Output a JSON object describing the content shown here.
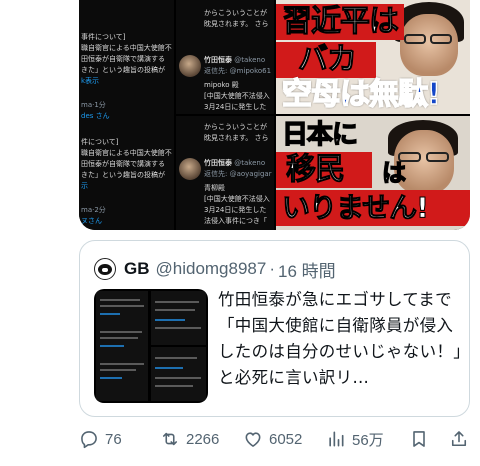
{
  "media": {
    "tile1": {
      "lines": [
        "事件について]",
        "職自衛官による中国大使館不",
        "田恒泰が自衛隊で講演する",
        "きた」という趣旨の投稿が",
        "k表示",
        "ma·1分",
        "des さん",
        "件について]",
        "職自衛官による中国大使館不",
        "田恒泰が自衛隊で講演する",
        "きた」という趣旨の投稿が",
        "示",
        "ma·2分",
        "ヌさん"
      ]
    },
    "tile2": {
      "top_lines": [
        "からこういうことが",
        "眈見されます。 さら"
      ],
      "name": "竹田恒泰",
      "handle": "@takeno",
      "reply_to": "返信先: @mipoko61",
      "body": [
        "mipoko 殿",
        "[中国大使館不法侵入",
        "3月24日に発生した",
        "法侵入事件につき「"
      ]
    },
    "tile3": {
      "top_lines": [
        "からこういうことが",
        "眈見されます。 さら"
      ],
      "name": "竹田恒泰",
      "handle": "@takeno",
      "reply_to": "返信先: @aoyagigar",
      "body": [
        "青柳殿",
        "[中国大使館不法侵入",
        "3月24日に発生した",
        "法侵入事件につき「"
      ]
    },
    "tile4": {
      "line1": "習近平は",
      "line2": "バカ",
      "line3": "空母は無駄!"
    },
    "tile5": {
      "line1": "日本に",
      "line2": "移民",
      "line3": "は",
      "line4": "いりません!"
    }
  },
  "quote": {
    "name": "GB",
    "handle": "@hidomg8987",
    "separator": "·",
    "time": "16 時間",
    "text": "竹田恒泰が急にエゴサしてまで「中国大使館に自衛隊員が侵入したのは自分のせいじゃない！」と必死に言い訳リ…"
  },
  "actions": {
    "replies": "76",
    "reposts": "2266",
    "likes": "6052",
    "views": "56万"
  },
  "colors": {
    "secondary_text": "#536471",
    "link_blue": "#1d9bf0",
    "banner_red": "#d11a1a",
    "banner_blue": "#1446c8"
  },
  "icons": [
    "reply-icon",
    "repost-icon",
    "like-icon",
    "views-icon",
    "bookmark-icon",
    "share-icon"
  ]
}
